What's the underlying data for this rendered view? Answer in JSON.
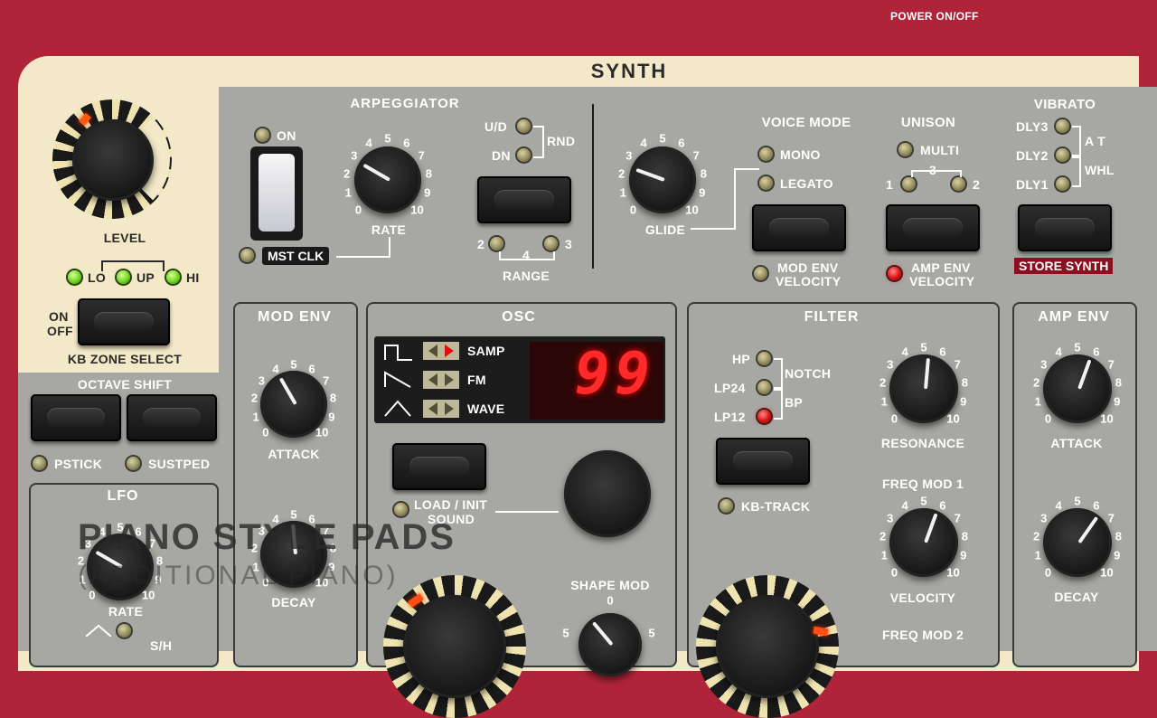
{
  "header": {
    "power": "POWER ON/OFF",
    "synth": "SYNTH"
  },
  "level": {
    "label": "LEVEL"
  },
  "kbzone": {
    "lo": "LO",
    "up": "UP",
    "hi": "HI",
    "on": "ON",
    "off": "OFF",
    "label": "KB ZONE SELECT"
  },
  "octave": {
    "label": "OCTAVE SHIFT",
    "pstick": "PSTICK",
    "sustped": "SUSTPED"
  },
  "arp": {
    "title": "ARPEGGIATOR",
    "on": "ON",
    "mstclk": "MST CLK",
    "rate": "RATE",
    "ud": "U/D",
    "dn": "DN",
    "rnd": "RND",
    "range": "RANGE",
    "r2": "2",
    "r3": "3",
    "r4": "4"
  },
  "glide": {
    "label": "GLIDE"
  },
  "voice": {
    "title": "VOICE MODE",
    "mono": "MONO",
    "legato": "LEGATO",
    "modenv1": "MOD ENV",
    "modenv2": "VELOCITY"
  },
  "unison": {
    "title": "UNISON",
    "multi": "MULTI",
    "n1": "1",
    "n2": "2",
    "n3": "3",
    "ampenv1": "AMP ENV",
    "ampenv2": "VELOCITY"
  },
  "vibrato": {
    "title": "VIBRATO",
    "dly3": "DLY3",
    "dly2": "DLY2",
    "dly1": "DLY1",
    "at": "A T",
    "whl": "WHL",
    "store": "STORE SYNTH"
  },
  "modenv": {
    "title": "MOD ENV",
    "attack": "ATTACK",
    "decay": "DECAY"
  },
  "osc": {
    "title": "OSC",
    "samp": "SAMP",
    "fm": "FM",
    "wave": "WAVE",
    "display": "99",
    "load1": "LOAD / INIT",
    "load2": "SOUND",
    "shapemod": "SHAPE MOD"
  },
  "filter": {
    "title": "FILTER",
    "hp": "HP",
    "lp24": "LP24",
    "lp12": "LP12",
    "notch": "NOTCH",
    "bp": "BP",
    "kbtrack": "KB-TRACK",
    "resonance": "RESONANCE",
    "fm1": "FREQ MOD 1",
    "velocity": "VELOCITY",
    "fm2": "FREQ MOD 2"
  },
  "ampenv": {
    "title": "AMP ENV",
    "attack": "ATTACK",
    "decay": "DECAY"
  },
  "lfo": {
    "title": "LFO",
    "rate": "RATE",
    "sh": "S/H"
  },
  "scale": {
    "s0": "0",
    "s1": "1",
    "s2": "2",
    "s3": "3",
    "s4": "4",
    "s5": "5",
    "s6": "6",
    "s7": "7",
    "s8": "8",
    "s9": "9",
    "s10": "10"
  },
  "overlay": {
    "title": "PIANO STYLE PADS",
    "subtitle": "(ADDITIONAL PIANO)"
  },
  "colors": {
    "red": "#b0243a",
    "cream": "#f3e9c8",
    "grey": "#a7a7a3",
    "dark": "#1a1a1a"
  }
}
